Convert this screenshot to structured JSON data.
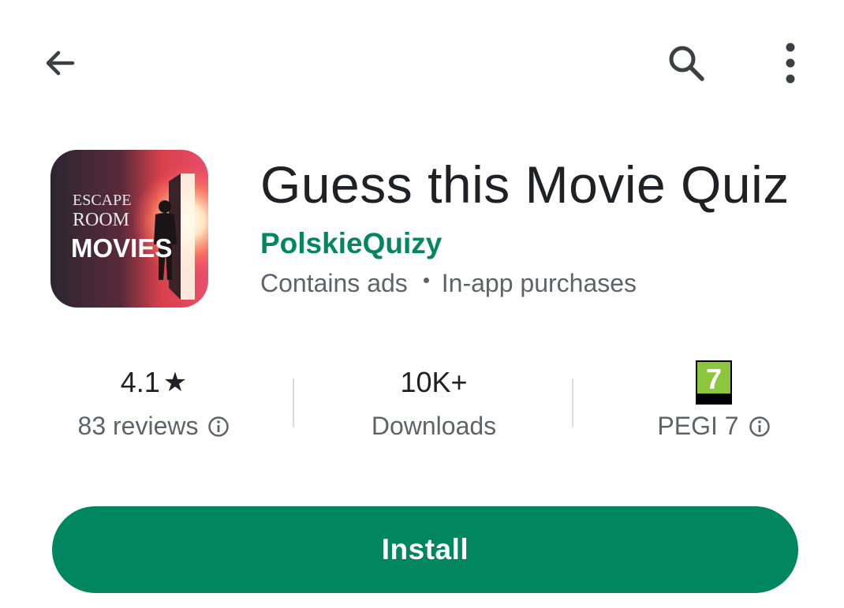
{
  "app": {
    "title": "Guess this Movie Quiz",
    "developer": "PolskieQuizy",
    "meta": [
      "Contains ads",
      "In-app purchases"
    ],
    "icon_text": [
      "ESCAPE",
      "ROOM",
      "MOVIES"
    ]
  },
  "stats": {
    "rating": {
      "value": "4.1",
      "star": "★",
      "label": "83 reviews"
    },
    "downloads": {
      "value": "10K+",
      "label": "Downloads"
    },
    "content_rating": {
      "badge": "7",
      "label": "PEGI 7"
    }
  },
  "actions": {
    "install_label": "Install"
  },
  "colors": {
    "accent": "#01875f",
    "pegi_green": "#8cc63f"
  },
  "icons": [
    "back-arrow-icon",
    "search-icon",
    "more-vert-icon",
    "info-icon"
  ]
}
